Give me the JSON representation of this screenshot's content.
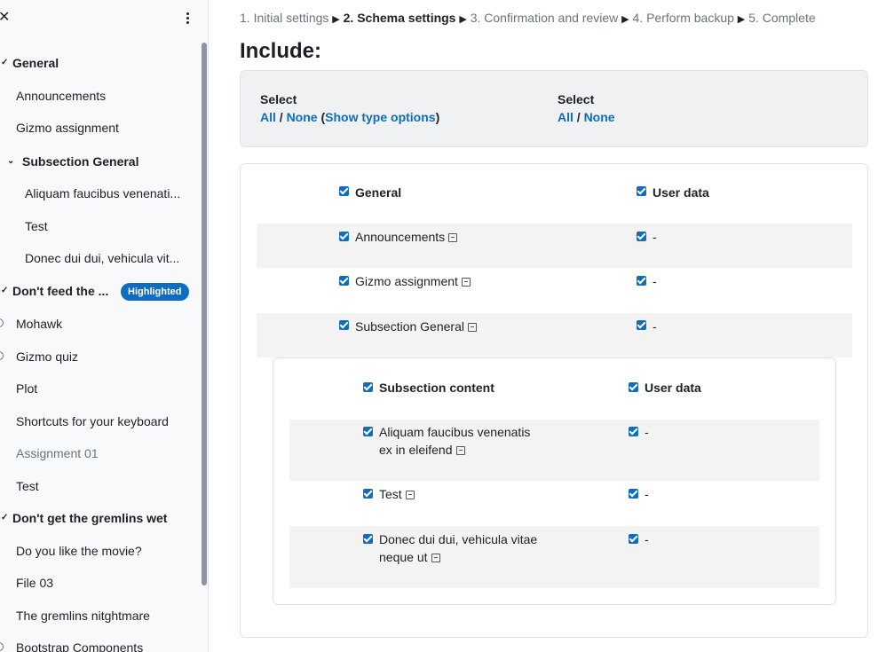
{
  "sidebar": {
    "close_glyph": "✕",
    "items": [
      {
        "label": "General"
      },
      {
        "label": "Announcements"
      },
      {
        "label": "Gizmo assignment"
      },
      {
        "label": "Subsection General"
      },
      {
        "label": "Aliquam faucibus venenati..."
      },
      {
        "label": "Test"
      },
      {
        "label": "Donec dui dui, vehicula vit..."
      },
      {
        "label": "Don't feed the ..."
      },
      {
        "label": "Mohawk"
      },
      {
        "label": "Gizmo quiz"
      },
      {
        "label": "Plot"
      },
      {
        "label": "Shortcuts for your keyboard"
      },
      {
        "label": "Assignment 01"
      },
      {
        "label": "Test"
      },
      {
        "label": "Don't get the gremlins wet"
      },
      {
        "label": "Do you like the movie?"
      },
      {
        "label": "File 03"
      },
      {
        "label": "The gremlins nitghtmare"
      },
      {
        "label": "Bootstrap Components"
      }
    ],
    "badge": "Highlighted"
  },
  "stepper": {
    "step1": "1. Initial settings",
    "step2": "2. Schema settings",
    "step3": "3. Confirmation and review",
    "step4": "4. Perform backup",
    "step5": "5. Complete",
    "separator": "▶"
  },
  "title": "Include:",
  "select": {
    "left": {
      "label": "Select",
      "all": "All",
      "none": "None",
      "show_types": "Show type options"
    },
    "right": {
      "label": "Select",
      "all": "All",
      "none": "None"
    }
  },
  "schema": {
    "header": {
      "name": "General",
      "userdata": "User data"
    },
    "rows": [
      {
        "name": "Announcements",
        "userdata": "-"
      },
      {
        "name": "Gizmo assignment",
        "userdata": "-"
      },
      {
        "name": "Subsection General",
        "userdata": "-"
      }
    ],
    "sub_header": {
      "name": "Subsection content",
      "userdata": "User data"
    },
    "sub_rows": [
      {
        "name_line1": "Aliquam faucibus venenatis",
        "name_line2": "ex in eleifend",
        "userdata": "-"
      },
      {
        "name_line1": "Test",
        "userdata": "-"
      },
      {
        "name_line1": "Donec dui dui, vehicula vitae",
        "name_line2": "neque ut",
        "userdata": "-"
      }
    ]
  }
}
